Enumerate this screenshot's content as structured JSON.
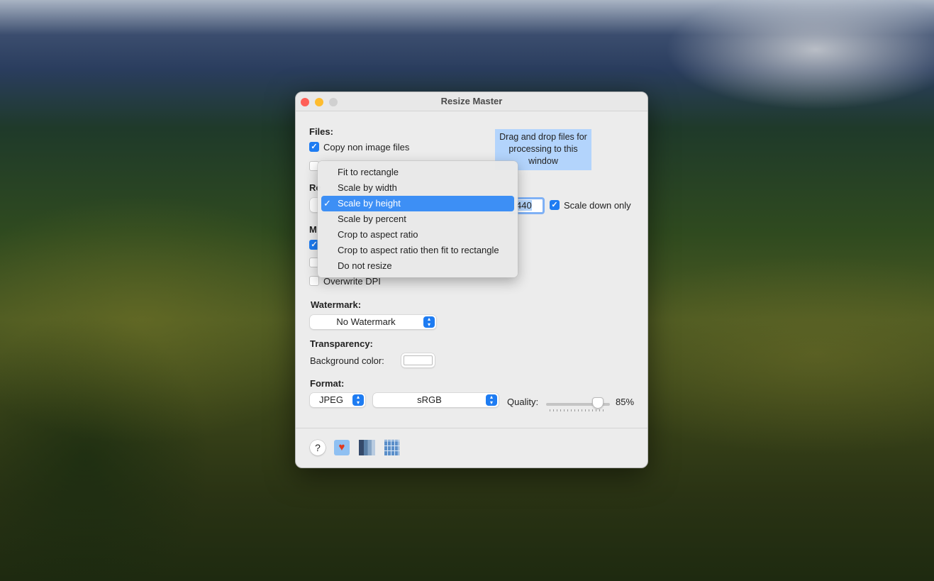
{
  "window": {
    "title": "Resize Master"
  },
  "files": {
    "label": "Files:",
    "copy_non_image": {
      "label": "Copy non image files",
      "checked": true
    },
    "second_checked": false
  },
  "drop_hint": "Drag and drop files for processing to this window",
  "resize": {
    "label_partial": "Re",
    "size_value": "440",
    "scale_down_only": {
      "label": "Scale down only",
      "checked": true
    }
  },
  "metadata": {
    "label_partial": "M",
    "opt1_checked": true,
    "opt2_checked": false,
    "overwrite_dpi": {
      "label": "Overwrite DPI",
      "checked": false
    }
  },
  "resize_menu": {
    "items": [
      "Fit to rectangle",
      "Scale by width",
      "Scale by height",
      "Scale by percent",
      "Crop to aspect ratio",
      "Crop to aspect ratio then fit to rectangle",
      "Do not resize"
    ],
    "selected": "Scale by height",
    "check": "✓"
  },
  "watermark": {
    "label": "Watermark:",
    "value": "No Watermark"
  },
  "transparency": {
    "label": "Transparency:",
    "bg_label": "Background color:",
    "bg_color": "#ffffff"
  },
  "format": {
    "label": "Format:",
    "type": "JPEG",
    "colorspace": "sRGB",
    "quality_label": "Quality:",
    "quality": 85,
    "quality_text": "85%"
  },
  "footer": {
    "help": "?",
    "icons": [
      "tulip-icon",
      "book-icon",
      "grid-icon"
    ]
  },
  "colors": {
    "accent": "#1e7cf2",
    "highlight": "#3d8ff5",
    "drop_bg": "#b3d4fc"
  }
}
